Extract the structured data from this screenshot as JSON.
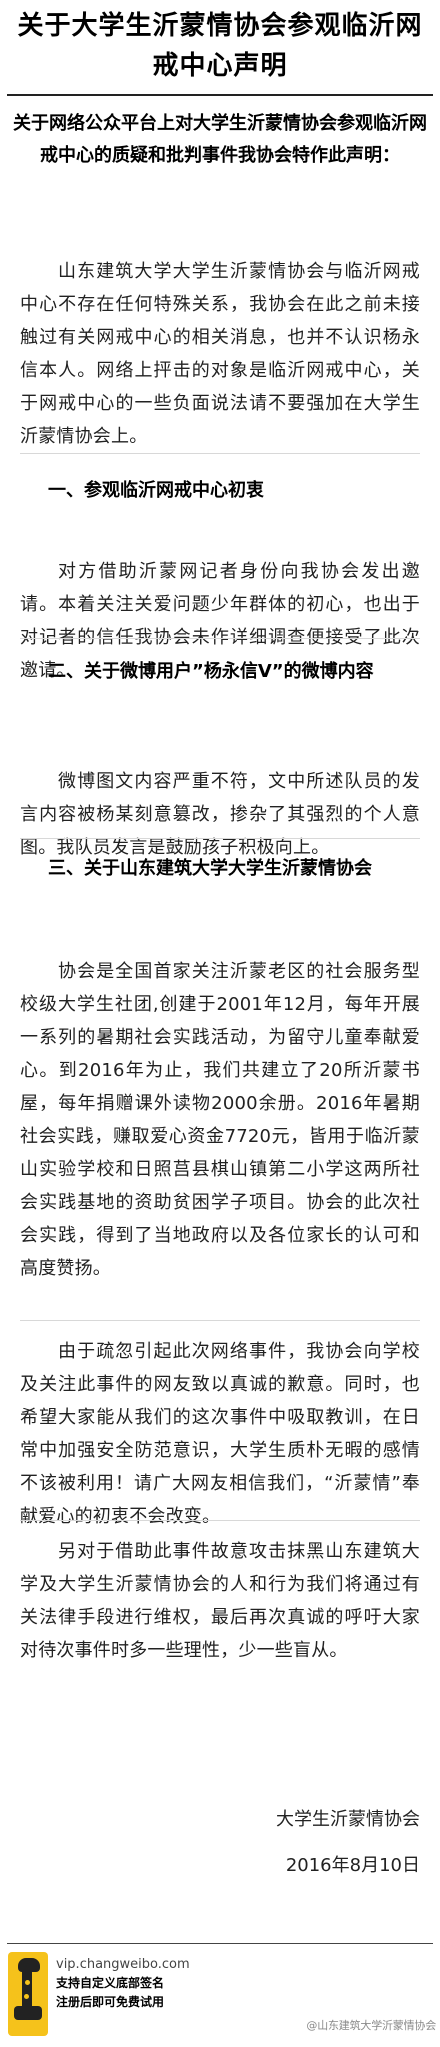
{
  "document": {
    "title": "关于大学生沂蒙情协会参观临沂网戒中心声明",
    "intro": "关于网络公众平台上对大学生沂蒙情协会参观临沂网戒中心的质疑和批判事件我协会特作此声明：",
    "paragraph_1": "山东建筑大学大学生沂蒙情协会与临沂网戒中心不存在任何特殊关系，我协会在此之前未接触过有关网戒中心的相关消息，也并不认识杨永信本人。网络上抨击的对象是临沂网戒中心，关于网戒中心的一些负面说法请不要强加在大学生沂蒙情协会上。",
    "section_1": {
      "heading": "一、参观临沂网戒中心初衷",
      "body": "对方借助沂蒙网记者身份向我协会发出邀请。本着关注关爱问题少年群体的初心，也出于对记者的信任我协会未作详细调查便接受了此次邀请。"
    },
    "section_2": {
      "heading": "二、关于微博用户”杨永信V”的微博内容",
      "body": "微博图文内容严重不符，文中所述队员的发言内容被杨某刻意篡改，掺杂了其强烈的个人意图。我队员发言是鼓励孩子积极向上。"
    },
    "section_3": {
      "heading": "三、关于山东建筑大学大学生沂蒙情协会",
      "body_1": "协会是全国首家关注沂蒙老区的社会服务型校级大学生社团,创建于2001年12月，每年开展一系列的暑期社会实践活动，为留守儿童奉献爱心。到2016年为止，我们共建立了20所沂蒙书屋，每年捐赠课外读物2000余册。2016年暑期社会实践，赚取爱心资金7720元，皆用于临沂蒙山实验学校和日照莒县棋山镇第二小学这两所社会实践基地的资助贫困学子项目。协会的此次社会实践，得到了当地政府以及各位家长的认可和高度赞扬。",
      "body_2": "由于疏忽引起此次网络事件，我协会向学校及关注此事件的网友致以真诚的歉意。同时，也希望大家能从我们的这次事件中吸取教训，在日常中加强安全防范意识，大学生质朴无暇的感情不该被利用！请广大网友相信我们，“沂蒙情”奉献爱心的初衷不会改变。",
      "body_3": "另对于借助此事件故意攻击抹黑山东建筑大学及大学生沂蒙情协会的人和行为我们将通过有关法律手段进行维权，最后再次真诚的呼吁大家对待次事件时多一些理性，少一些盲从。"
    },
    "signature": {
      "organization": "大学生沂蒙情协会",
      "date": "2016年8月10日"
    }
  },
  "footer": {
    "logo_icon": "giraffe-logo-icon",
    "url": "vip.changweibo.com",
    "line_1": "支持自定义底部签名",
    "line_2": "注册后即可免费试用",
    "watermark": "@山东建筑大学沂蒙情协会"
  },
  "colors": {
    "logo_yellow": "#f5c21b",
    "text": "#222222"
  }
}
